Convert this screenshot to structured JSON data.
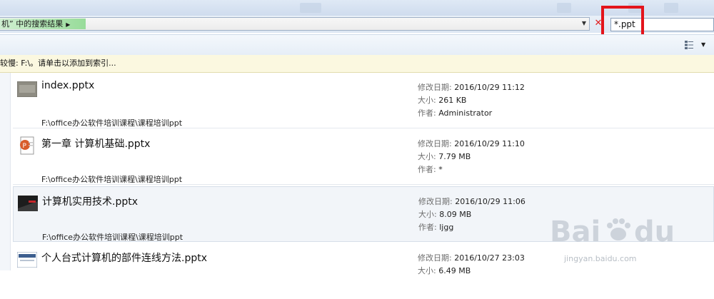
{
  "address_bar": {
    "breadcrumb": "机” 中的搜索结果",
    "arrow_icon": "chevron-right-icon"
  },
  "search": {
    "query": "*.ppt",
    "clear_icon": "close-icon",
    "highlight_color": "#e3141b"
  },
  "toolbar": {
    "view_icon": "details-view-icon"
  },
  "info_bar": {
    "message": "较慢: F:\\。请单击以添加到索引..."
  },
  "meta_labels": {
    "modified": "修改日期:",
    "size": "大小:",
    "author": "作者:"
  },
  "results": [
    {
      "name": "index.pptx",
      "modified": "2016/10/29 11:12",
      "size": "261 KB",
      "author": "Administrator",
      "path": "F:\\office办公软件培训课程\\课程培训ppt",
      "thumb": "slide-thumbnail-gray"
    },
    {
      "name": "第一章 计算机基础.pptx",
      "modified": "2016/10/29 11:10",
      "size": "7.79 MB",
      "author": "*",
      "path": "F:\\office办公软件培训课程\\课程培训ppt",
      "thumb": "powerpoint-file-icon"
    },
    {
      "name": "计算机实用技术.pptx",
      "modified": "2016/10/29 11:06",
      "size": "8.09 MB",
      "author": "ljgg",
      "path": "F:\\office办公软件培训课程\\课程培训ppt",
      "thumb": "slide-thumbnail-dark"
    },
    {
      "name": "个人台式计算机的部件连线方法.pptx",
      "modified": "2016/10/27 23:03",
      "size": "6.49 MB",
      "author": "",
      "path": "",
      "thumb": "slide-thumbnail-blue"
    }
  ],
  "watermark": {
    "brand": "Bai du 经验",
    "url": "jingyan.baidu.com"
  }
}
